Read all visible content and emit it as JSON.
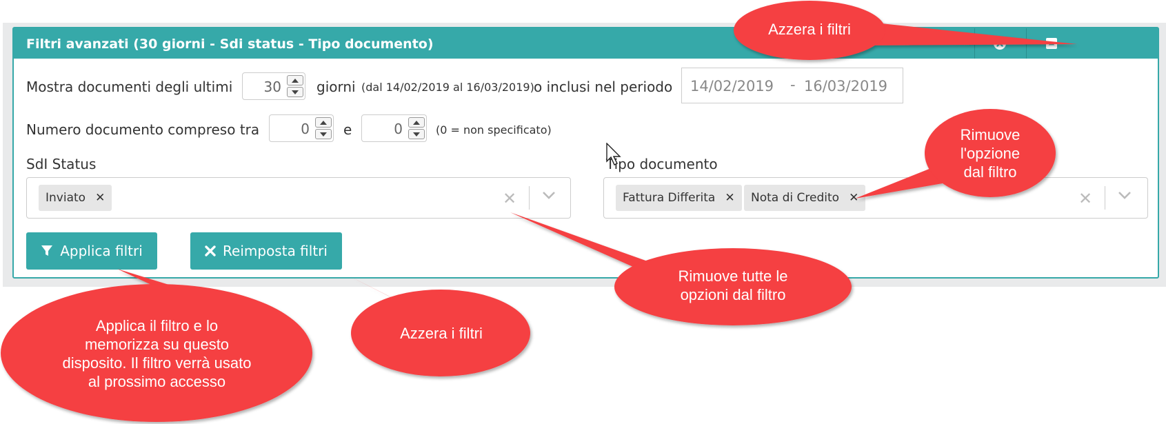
{
  "panel": {
    "title": "Filtri avanzati  (30 giorni - Sdi status - Tipo documento)"
  },
  "row1": {
    "label_before": "Mostra documenti degli ultimi",
    "days_value": "30",
    "label_giorni": "giorni",
    "range_note": "(dal 14/02/2019 al 16/03/2019)",
    "label_after": "o inclusi nel periodo",
    "date_from": "14/02/2019",
    "date_sep": "-",
    "date_to": "16/03/2019"
  },
  "row2": {
    "label": "Numero documento compreso tra",
    "from_value": "0",
    "label_and": "e",
    "to_value": "0",
    "note": "(0 = non specificato)"
  },
  "sdi": {
    "label": "SdI Status",
    "tags": [
      "Inviato"
    ]
  },
  "tipo": {
    "label": "Tipo documento",
    "tags": [
      "Fattura Differita",
      "Nota di Credito"
    ]
  },
  "buttons": {
    "apply": "Applica filtri",
    "reset": "Reimposta filtri"
  },
  "callouts": {
    "top": "Azzera i filtri",
    "remove_option": "Rimuove\nl'opzione\ndal filtro",
    "remove_all": "Rimuove tutte le\nopzioni dal filtro",
    "apply_note": "Applica il filtro e lo\nmemorizza su questo\ndisposito. Il filtro verrà usato\nal prossimo accesso",
    "reset_note": "Azzera i filtri"
  },
  "colors": {
    "teal": "#36a9a9",
    "callout": "#f53f42"
  }
}
